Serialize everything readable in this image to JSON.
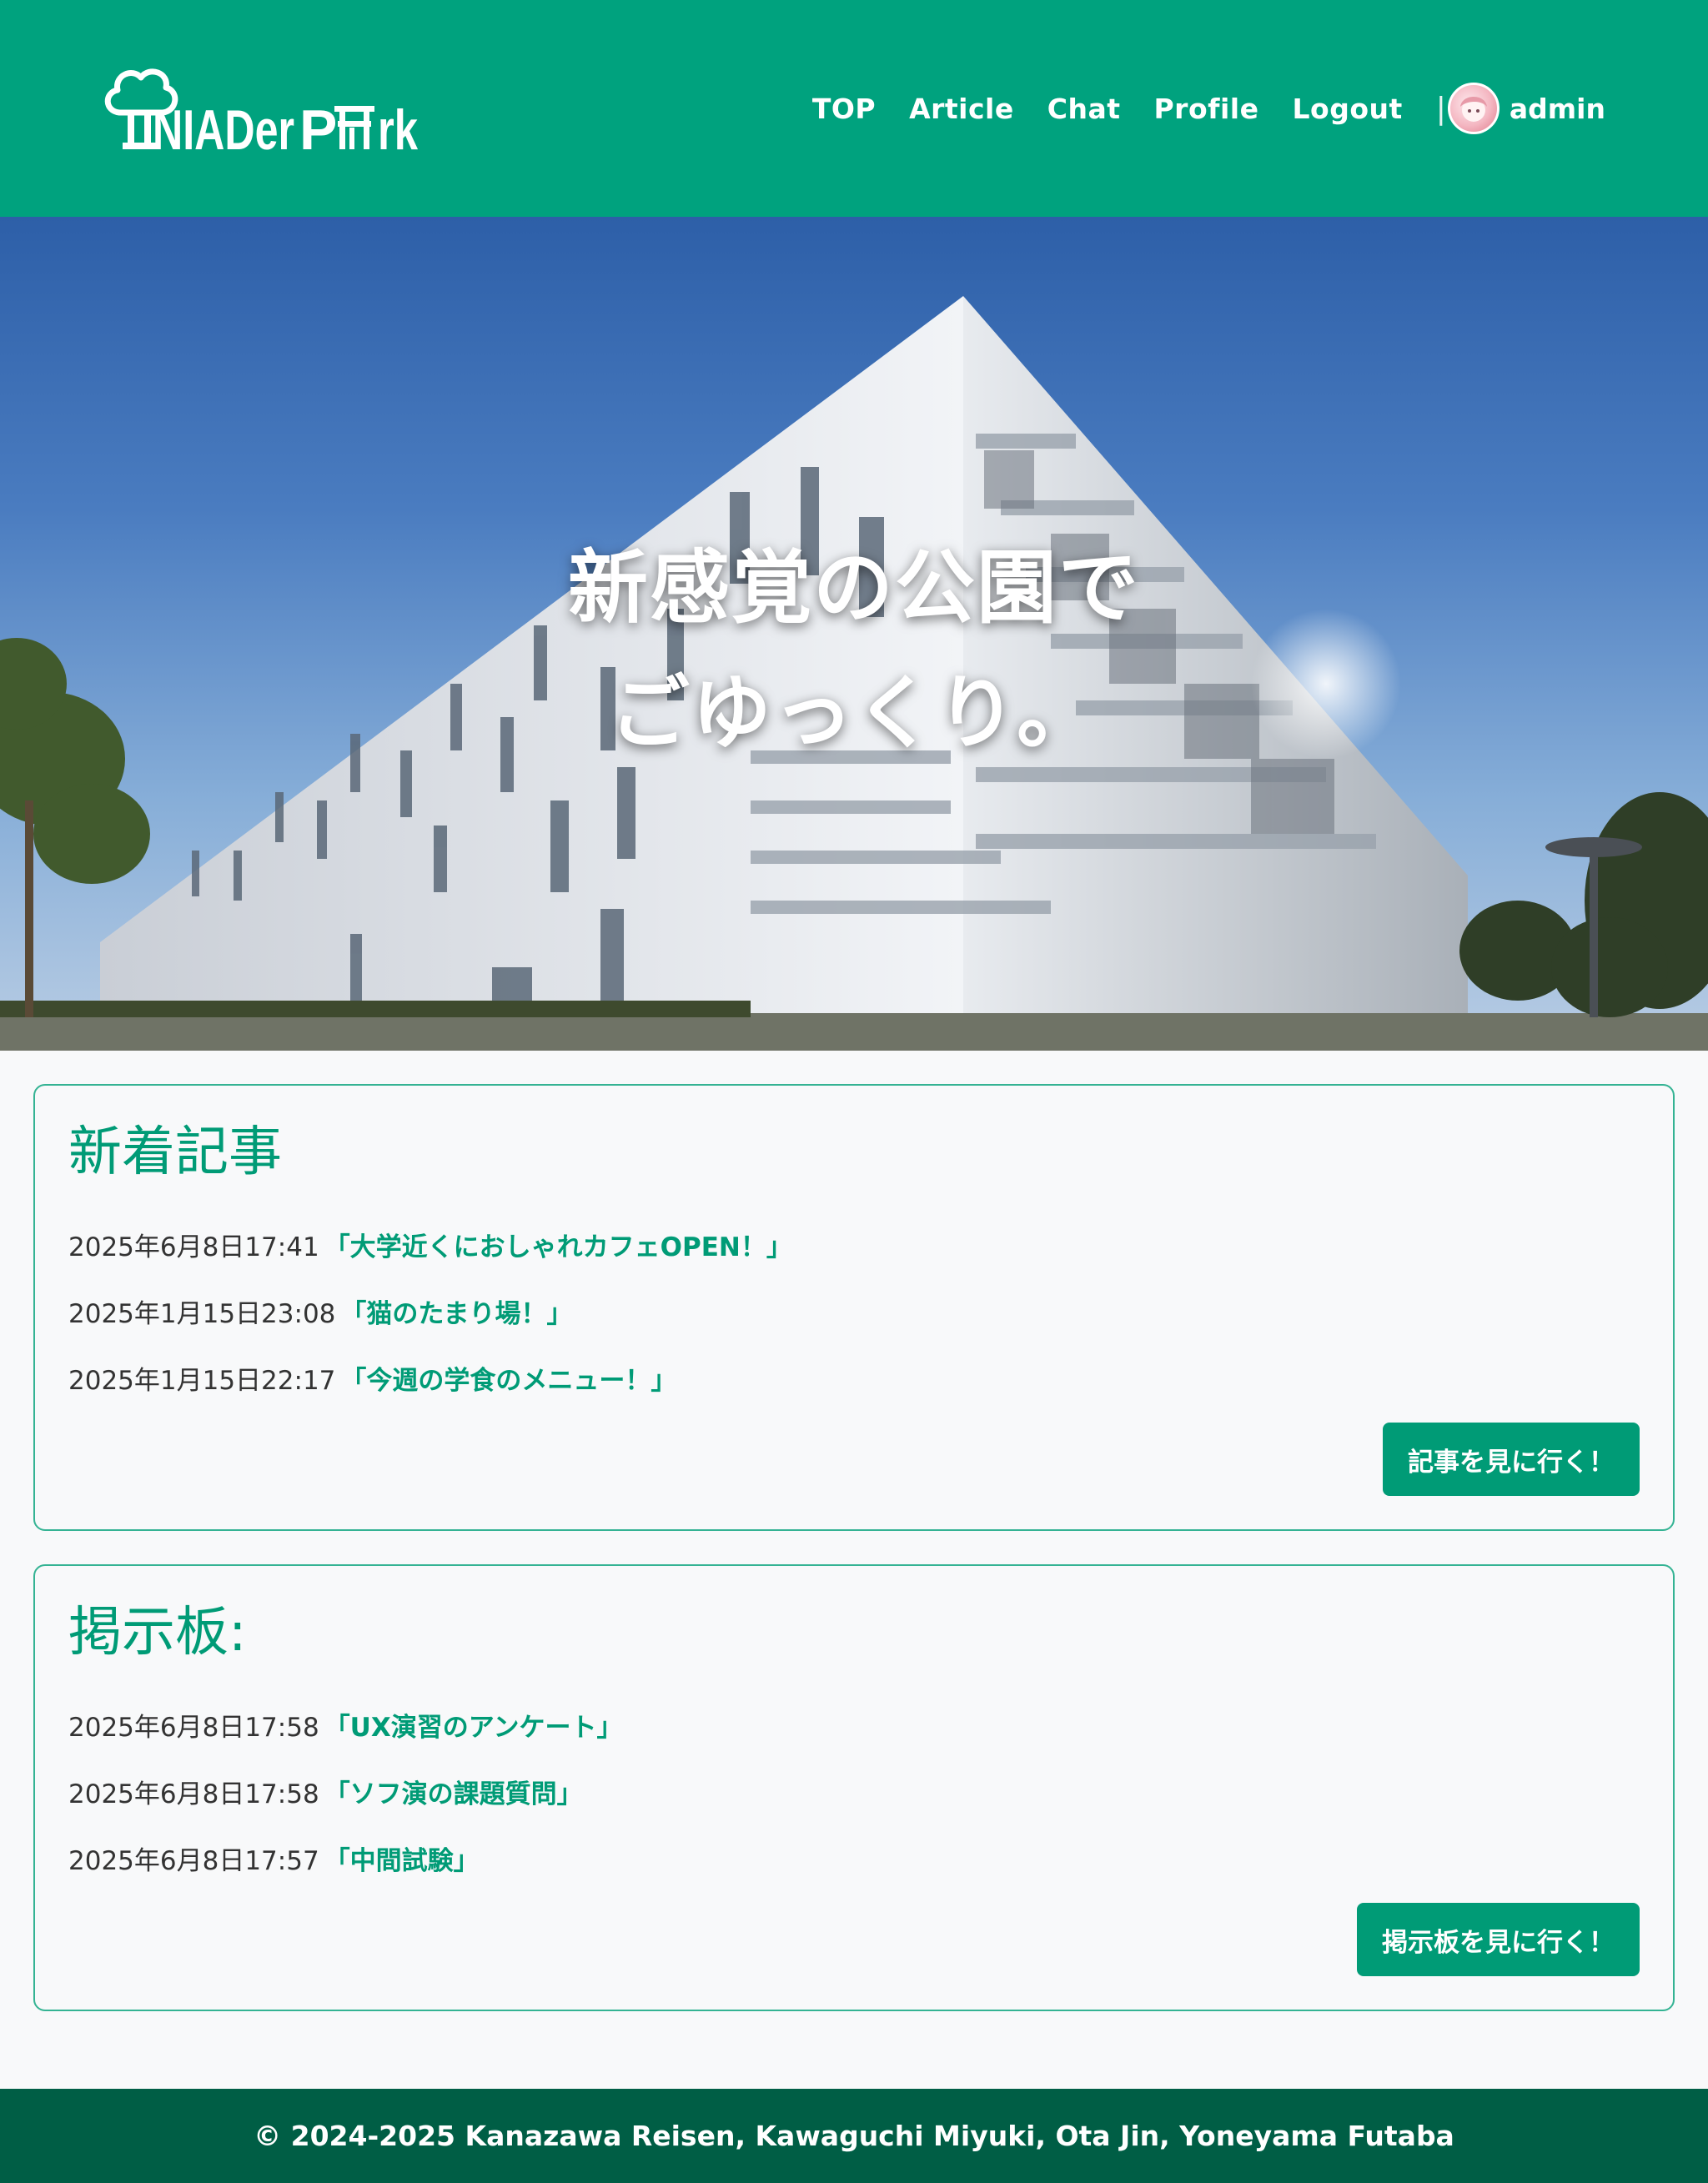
{
  "header": {
    "logo_text": "NIADer Park",
    "nav": [
      "TOP",
      "Article",
      "Chat",
      "Profile",
      "Logout"
    ],
    "separator": "|",
    "user_name": "admin",
    "brand_color": "#00a27e"
  },
  "hero": {
    "line1": "新感覚の公園で",
    "line2": "ごゆっくり。"
  },
  "articles": {
    "title": "新着記事",
    "items": [
      {
        "date": "2025年6月8日17:41",
        "title": "「大学近くにおしゃれカフェOPEN！」"
      },
      {
        "date": "2025年1月15日23:08",
        "title": "「猫のたまり場！」"
      },
      {
        "date": "2025年1月15日22:17",
        "title": "「今週の学食のメニュー！」"
      }
    ],
    "button": "記事を見に行く！"
  },
  "board": {
    "title": "掲示板:",
    "items": [
      {
        "date": "2025年6月8日17:58",
        "title": "「UX演習のアンケート」"
      },
      {
        "date": "2025年6月8日17:58",
        "title": "「ソフ演の課題質問」"
      },
      {
        "date": "2025年6月8日17:57",
        "title": "「中間試験」"
      }
    ],
    "button": "掲示板を見に行く！"
  },
  "footer": {
    "text": "© 2024-2025 Kanazawa Reisen, Kawaguchi Miyuki, Ota Jin, Yoneyama Futaba"
  }
}
